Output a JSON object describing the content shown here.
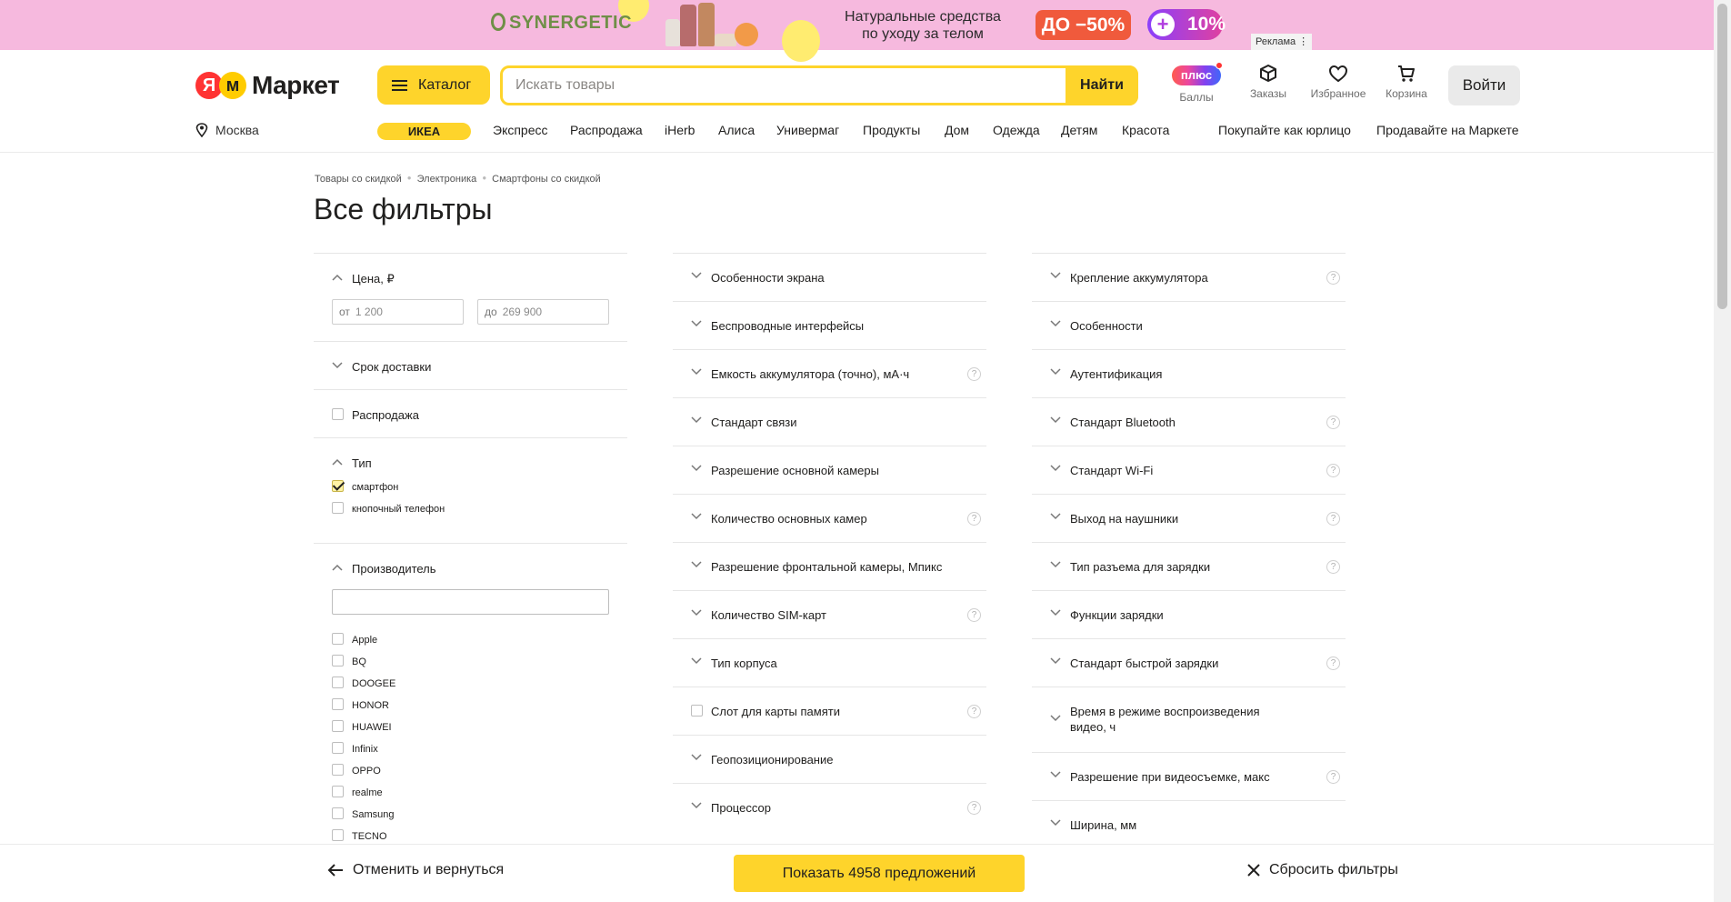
{
  "ad": {
    "brand": "SYNERGETIC",
    "text_line1": "Натуральные средства",
    "text_line2": "по уходу за телом",
    "discount": "ДО −50%",
    "plus_percent": "10%",
    "label": "Реклама"
  },
  "header": {
    "logo_text": "Маркет",
    "catalog_label": "Каталог",
    "search_placeholder": "Искать товары",
    "search_button": "Найти",
    "plus_badge": "плюс",
    "icons": [
      {
        "name": "points",
        "label": "Баллы"
      },
      {
        "name": "orders",
        "label": "Заказы"
      },
      {
        "name": "favorites",
        "label": "Избранное"
      },
      {
        "name": "cart",
        "label": "Корзина"
      }
    ],
    "login_label": "Войти",
    "city": "Москва",
    "promo_chip": "ИКЕА",
    "nav": [
      "Экспресс",
      "Распродажа",
      "iHerb",
      "Алиса",
      "Универмаг",
      "Продукты",
      "Дом",
      "Одежда",
      "Детям",
      "Красота"
    ],
    "nav_right": [
      "Покупайте как юрлицо",
      "Продавайте на Маркете"
    ]
  },
  "breadcrumbs": [
    "Товары со скидкой",
    "Электроника",
    "Смартфоны со скидкой"
  ],
  "page_title": "Все фильтры",
  "left": {
    "price": {
      "label": "Цена, ₽",
      "from_prefix": "от",
      "from_value": "1 200",
      "to_prefix": "до",
      "to_value": "269 900"
    },
    "delivery_label": "Срок доставки",
    "sale_label": "Распродажа",
    "type": {
      "label": "Тип",
      "options": [
        {
          "label": "смартфон",
          "checked": true
        },
        {
          "label": "кнопочный телефон",
          "checked": false
        }
      ]
    },
    "manufacturer": {
      "label": "Производитель",
      "options": [
        "Apple",
        "BQ",
        "DOOGEE",
        "HONOR",
        "HUAWEI",
        "Infinix",
        "OPPO",
        "realme",
        "Samsung",
        "TECNO"
      ]
    }
  },
  "middle_filters": [
    {
      "label": "Особенности экрана",
      "help": false,
      "kind": "chevron"
    },
    {
      "label": "Беспроводные интерфейсы",
      "help": false,
      "kind": "chevron"
    },
    {
      "label": "Емкость аккумулятора (точно), мА·ч",
      "help": true,
      "kind": "chevron"
    },
    {
      "label": "Стандарт связи",
      "help": false,
      "kind": "chevron"
    },
    {
      "label": "Разрешение основной камеры",
      "help": false,
      "kind": "chevron"
    },
    {
      "label": "Количество основных камер",
      "help": true,
      "kind": "chevron"
    },
    {
      "label": "Разрешение фронтальной камеры, Мпикс",
      "help": false,
      "kind": "chevron"
    },
    {
      "label": "Количество SIM-карт",
      "help": true,
      "kind": "chevron"
    },
    {
      "label": "Тип корпуса",
      "help": false,
      "kind": "chevron"
    },
    {
      "label": "Слот для карты памяти",
      "help": true,
      "kind": "checkbox"
    },
    {
      "label": "Геопозиционирование",
      "help": false,
      "kind": "chevron"
    },
    {
      "label": "Процессор",
      "help": true,
      "kind": "chevron"
    }
  ],
  "right_filters": [
    {
      "label": "Крепление аккумулятора",
      "help": true
    },
    {
      "label": "Особенности",
      "help": false
    },
    {
      "label": "Аутентификация",
      "help": false
    },
    {
      "label": "Стандарт Bluetooth",
      "help": true
    },
    {
      "label": "Стандарт Wi-Fi",
      "help": true
    },
    {
      "label": "Выход на наушники",
      "help": true
    },
    {
      "label": "Тип разъема для зарядки",
      "help": true
    },
    {
      "label": "Функции зарядки",
      "help": false
    },
    {
      "label": "Стандарт быстрой зарядки",
      "help": true
    },
    {
      "label": "Время в режиме воспроизведения видео, ч",
      "help": false,
      "tall": true
    },
    {
      "label": "Разрешение при видеосъемке, макс",
      "help": true
    },
    {
      "label": "Ширина, мм",
      "help": false
    }
  ],
  "bottom": {
    "cancel_label": "Отменить и вернуться",
    "show_label": "Показать 4958 предложений",
    "reset_label": "Сбросить фильтры"
  },
  "colors": {
    "accent": "#fed42b",
    "ad_bg": "#f6b9de",
    "discount": "#f05a3c"
  }
}
